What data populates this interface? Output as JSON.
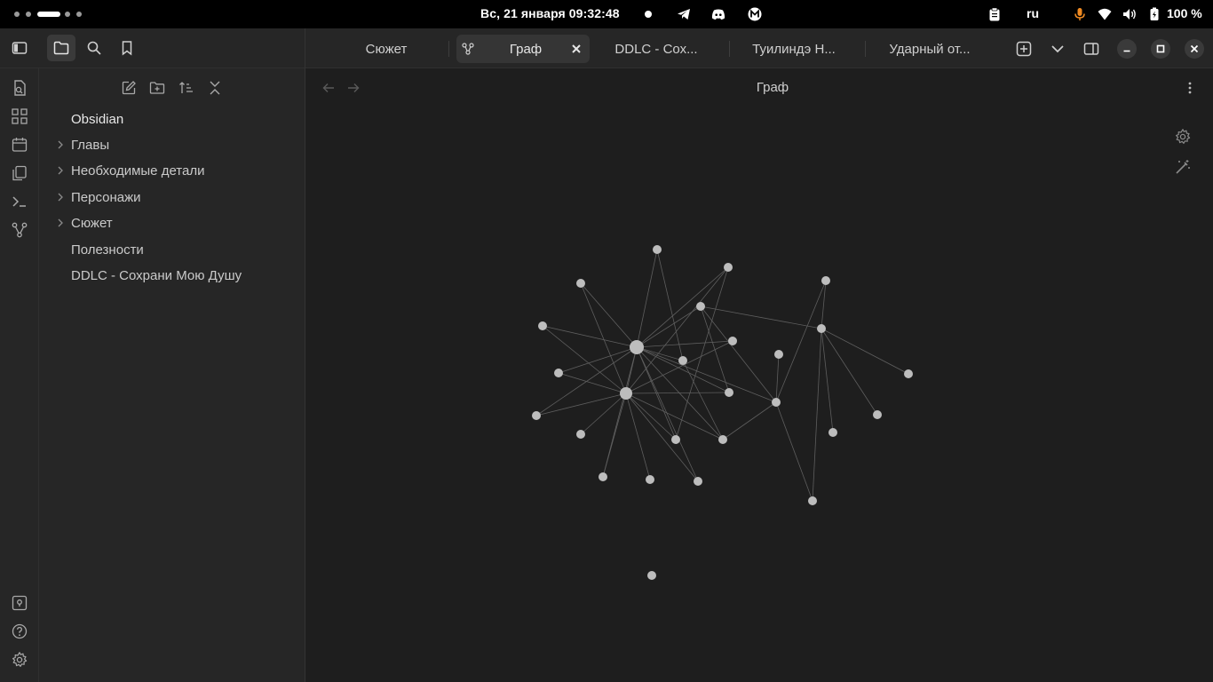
{
  "topbar": {
    "datetime": "Вс, 21 января  09:32:48",
    "language": "ru",
    "battery": "100 %",
    "icons": [
      "telegram-icon",
      "discord-icon",
      "mailspring-icon",
      "clipboard-icon",
      "microphone-icon",
      "wifi-icon",
      "volume-icon",
      "battery-icon"
    ]
  },
  "toolbar": {
    "left_buttons": [
      "sidebar-toggle-icon",
      "files-icon",
      "search-icon",
      "bookmark-icon"
    ],
    "tabs": [
      {
        "label": "Сюжет",
        "active": false
      },
      {
        "label": "Граф",
        "active": true,
        "icon": "graph-icon"
      },
      {
        "label": "DDLC - Сох...",
        "active": false
      },
      {
        "label": "Туилиндэ Н...",
        "active": false
      },
      {
        "label": "Ударный от...",
        "active": false
      }
    ]
  },
  "ribbon": {
    "top": [
      "quick-switcher-icon",
      "canvas-icon",
      "calendar-icon",
      "templates-icon",
      "command-palette-icon",
      "graph-view-icon"
    ],
    "bottom": [
      "vault-switcher-icon",
      "help-icon",
      "settings-icon"
    ]
  },
  "explorer": {
    "actions": [
      "new-note-icon",
      "new-folder-icon",
      "sort-icon",
      "collapse-all-icon"
    ],
    "vault": "Obsidian",
    "items": [
      {
        "label": "Главы",
        "folder": true
      },
      {
        "label": "Необходимые детали",
        "folder": true
      },
      {
        "label": "Персонажи",
        "folder": true
      },
      {
        "label": "Сюжет",
        "folder": true
      },
      {
        "label": "Полезности",
        "folder": false
      },
      {
        "label": "DDLC - Сохрани Мою Душу",
        "folder": false
      }
    ]
  },
  "main": {
    "title": "Граф"
  },
  "colors": {
    "background": "#1e1e1e",
    "sidebar": "#262626",
    "node": "#bdbdbd",
    "edge": "#5e5e5e"
  }
}
